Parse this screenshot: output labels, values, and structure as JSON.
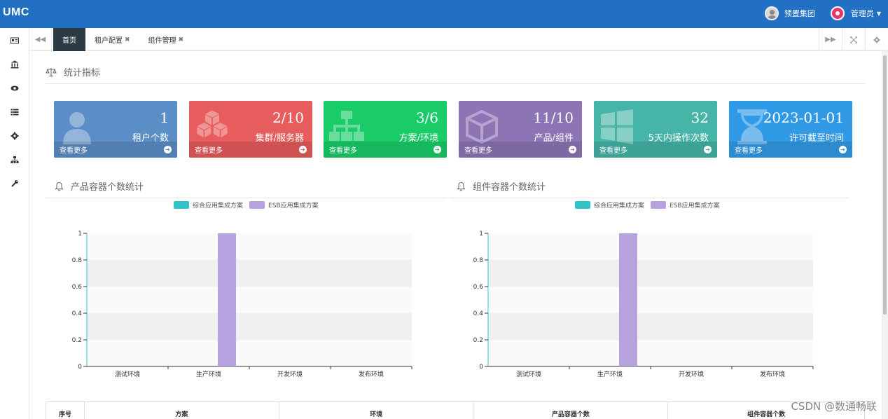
{
  "app": {
    "logo": "UMC"
  },
  "topbar": {
    "org_label": "预置集团",
    "user_label": "管理员"
  },
  "tabs": [
    {
      "label": "首页",
      "active": true,
      "closable": false
    },
    {
      "label": "租户配置",
      "active": false,
      "closable": true
    },
    {
      "label": "组件管理",
      "active": false,
      "closable": true
    }
  ],
  "sidebar": {
    "icons": [
      "id-card-icon",
      "bank-icon",
      "eye-icon",
      "list-icon",
      "gear-icon",
      "sitemap-icon",
      "wrench-icon"
    ]
  },
  "stats_section": {
    "title": "统计指标"
  },
  "cards": [
    {
      "value": "1",
      "label": "租户个数",
      "more": "查看更多",
      "color": "#5b8ec7",
      "icon": "user-icon"
    },
    {
      "value": "2/10",
      "label": "集群/服务器",
      "more": "查看更多",
      "color": "#e75c5c",
      "icon": "cubes-icon"
    },
    {
      "value": "3/6",
      "label": "方案/环境",
      "more": "查看更多",
      "color": "#19cc68",
      "icon": "sitemap-icon"
    },
    {
      "value": "11/10",
      "label": "产品/组件",
      "more": "查看更多",
      "color": "#8d74b5",
      "icon": "cube-icon"
    },
    {
      "value": "32",
      "label": "5天内操作次数",
      "more": "查看更多",
      "color": "#46b4a7",
      "icon": "windows-icon"
    },
    {
      "value": "2023-01-01",
      "label": "许可截至时间",
      "more": "查看更多",
      "color": "#319ae7",
      "icon": "hourglass-icon"
    }
  ],
  "chart_data": [
    {
      "type": "bar",
      "title": "产品容器个数统计",
      "categories": [
        "测试环境",
        "生产环境",
        "开发环境",
        "发布环境"
      ],
      "series": [
        {
          "name": "综合应用集成方案",
          "values": [
            0,
            0,
            0,
            0
          ],
          "color": "#32c3c9"
        },
        {
          "name": "ESB应用集成方案",
          "values": [
            0,
            1,
            0,
            0
          ],
          "color": "#b7a2e0"
        }
      ],
      "ylim": [
        0,
        1
      ],
      "yticks": [
        "0",
        "0.2",
        "0.4",
        "0.6",
        "0.8",
        "1"
      ],
      "legend": "top-center",
      "grid": true
    },
    {
      "type": "bar",
      "title": "组件容器个数统计",
      "categories": [
        "测试环境",
        "生产环境",
        "开发环境",
        "发布环境"
      ],
      "series": [
        {
          "name": "综合应用集成方案",
          "values": [
            0,
            0,
            0,
            0
          ],
          "color": "#32c3c9"
        },
        {
          "name": "ESB应用集成方案",
          "values": [
            0,
            1,
            0,
            0
          ],
          "color": "#b7a2e0"
        }
      ],
      "ylim": [
        0,
        1
      ],
      "yticks": [
        "0",
        "0.2",
        "0.4",
        "0.6",
        "0.8",
        "1"
      ],
      "legend": "top-center",
      "grid": true
    }
  ],
  "table": {
    "columns": [
      "序号",
      "方案",
      "环境",
      "产品容器个数",
      "组件容器个数"
    ]
  },
  "watermark": "CSDN @数通畅联"
}
